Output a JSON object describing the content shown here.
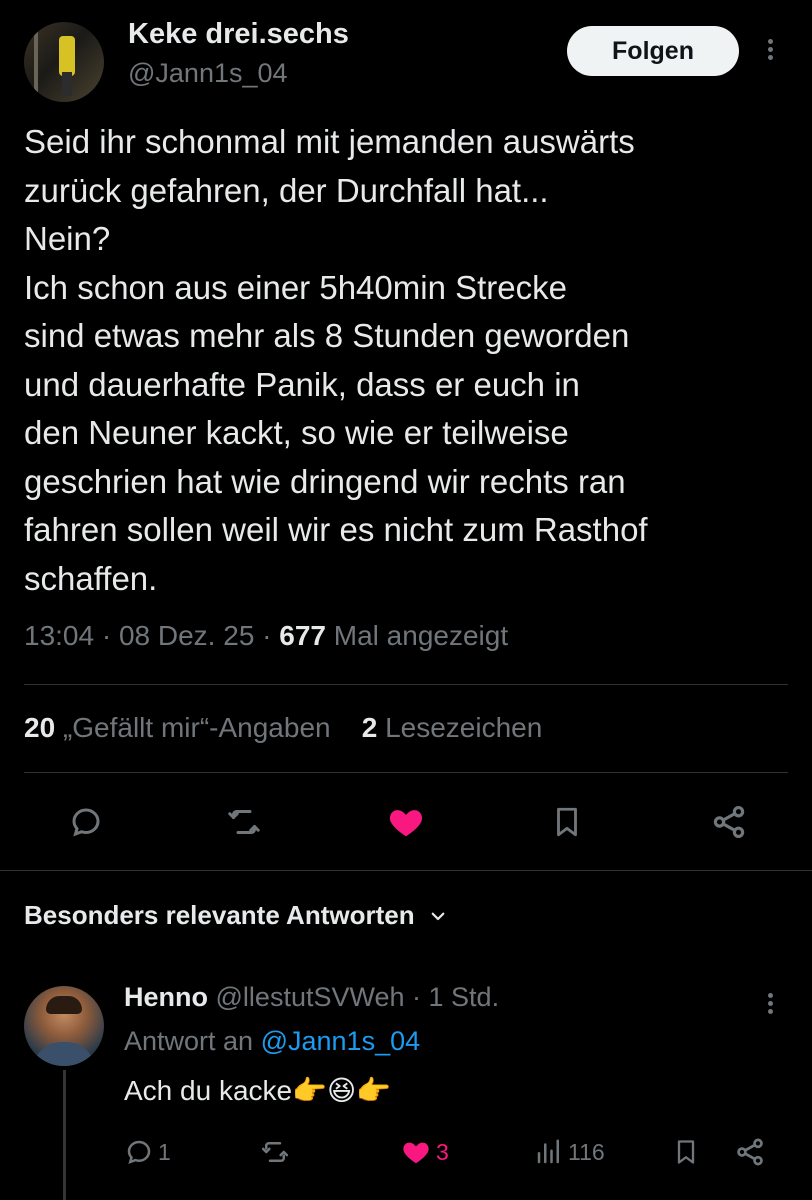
{
  "tweet": {
    "author_name": "Keke drei.sechs",
    "author_handle": "@Jann1s_04",
    "follow_label": "Folgen",
    "text": "Seid ihr schonmal mit jemanden auswärts\nzurück gefahren, der Durchfall hat...\nNein?\nIch schon aus einer 5h40min Strecke\nsind etwas mehr als 8 Stunden geworden\nund dauerhafte Panik, dass er euch in\nden Neuner kackt, so wie er teilweise\ngeschrien hat wie dringend wir rechts ran\nfahren sollen weil wir es nicht zum Rasthof\nschaffen.",
    "time": "13:04",
    "date": "08 Dez. 25",
    "views": "677",
    "views_label": "Mal angezeigt",
    "likes": "20",
    "likes_label": "„Gefällt mir“-Angaben",
    "bookmarks": "2",
    "bookmarks_label": "Lesezeichen"
  },
  "actions": {
    "icons": [
      "reply-icon",
      "retweet-icon",
      "like-icon-filled",
      "bookmark-icon",
      "share-icon"
    ],
    "like_color": "#f91880"
  },
  "replies_section": {
    "title": "Besonders relevante Antworten"
  },
  "reply": {
    "name": "Henno",
    "handle": "@llestutSVWeh",
    "time": "1 Std.",
    "reply_to_label": "Antwort an",
    "reply_to_handle": "@Jann1s_04",
    "text": "Ach du kacke",
    "emojis": "👉😆👉",
    "reply_count": "1",
    "retweet_count": "",
    "like_count": "3",
    "view_count": "116"
  },
  "colors": {
    "background": "#000000",
    "text": "#e7e9ea",
    "secondary": "#71767b",
    "link": "#1d9bf0",
    "like": "#f91880",
    "divider": "#2f3336"
  }
}
